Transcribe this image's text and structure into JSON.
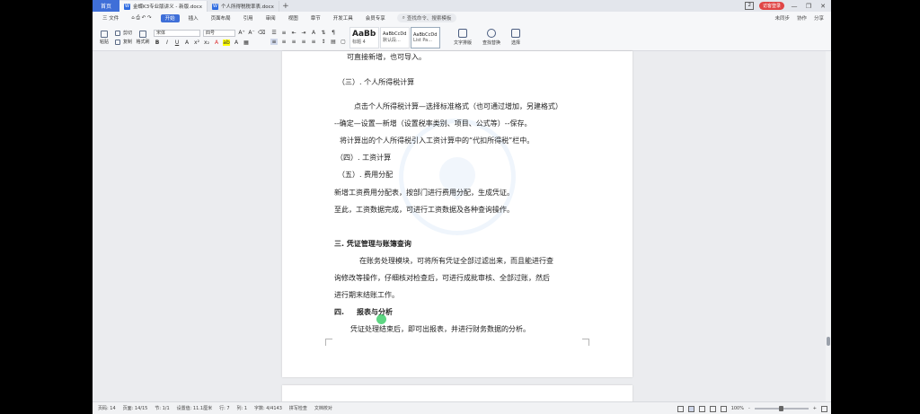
{
  "titlebar": {
    "home_tab": "首页",
    "tabs": [
      {
        "label": "金蝶K3专业版讲义 - 新版.docx",
        "active": true
      },
      {
        "label": "个人所得税税率表.docx",
        "active": false
      }
    ],
    "plus": "+",
    "count_badge": "2",
    "login_label": "访客登录",
    "min": "—",
    "max": "❐",
    "close": "✕"
  },
  "menubar": {
    "file": "三 文件",
    "items": [
      "开始",
      "插入",
      "页面布局",
      "引用",
      "审阅",
      "视图",
      "章节",
      "开发工具",
      "会员专享"
    ],
    "active_index": 0,
    "search": "查找命令、搜索模板",
    "right": [
      "未同步",
      "协作",
      "分享"
    ]
  },
  "ribbon": {
    "paste": "粘贴",
    "cut": "剪切",
    "copy": "复制",
    "format_painter": "格式刷",
    "font_name": "宋体",
    "font_size": "四号",
    "styles": [
      {
        "preview": "AaBbC",
        "label": "标题 4"
      },
      {
        "preview": "AaBbCcDd",
        "label": "默认段..."
      },
      {
        "preview": "AaBbCcDd",
        "label": "List Pa..."
      }
    ],
    "text_layout": "文字排版",
    "find_replace": "查找替换",
    "select": "选择"
  },
  "document": {
    "lines": [
      {
        "text": "可直接新增，也可导入。",
        "bold": false
      },
      {
        "text": "（三）. 个人所得税计算",
        "bold": false
      },
      {
        "text": "点击个人所得税计算—选择标准格式（也可通过增加，另建格式）",
        "bold": false
      },
      {
        "text": "--确定—设置—新增（设置税率类别、项目、公式等）--保存。",
        "bold": false
      },
      {
        "text": "将计算出的个人所得税引入工资计算中的“代扣所得税”栏中。",
        "bold": false
      },
      {
        "text": "（四）. 工资计算",
        "bold": false
      },
      {
        "text": "（五）. 费用分配",
        "bold": false
      },
      {
        "text": "新增工资费用分配表，按部门进行费用分配，生成凭证。",
        "bold": false
      },
      {
        "text": "至此，工资数据完成，可进行工资数据及各种查询操作。",
        "bold": false
      },
      {
        "text": "三. 凭证管理与账簿查询",
        "bold": true
      },
      {
        "text": "在账务处理模块，可将所有凭证全部过滤出来，而且能进行查",
        "bold": false
      },
      {
        "text": "询修改等操作，仔细核对检查后，可进行成批审核、全部过账，然后",
        "bold": false
      },
      {
        "text": "进行期末结账工作。",
        "bold": false
      },
      {
        "text": "四.     报表与分析",
        "bold": true
      },
      {
        "text": "凭证处理结束后，即可出报表，并进行财务数据的分析。",
        "bold": false
      }
    ]
  },
  "statusbar": {
    "page_num": "页码: 14",
    "pages": "页面: 14/15",
    "section": "节: 1/1",
    "position": "设置值: 11.1厘米",
    "row": "行: 7",
    "col": "列: 1",
    "word_count": "字数: 4/4143",
    "spellcheck": "拼写检查",
    "doc_check": "文档校对",
    "zoom": "100%",
    "zoom_minus": "-",
    "zoom_plus": "+",
    "zoom_level": 0.5
  }
}
